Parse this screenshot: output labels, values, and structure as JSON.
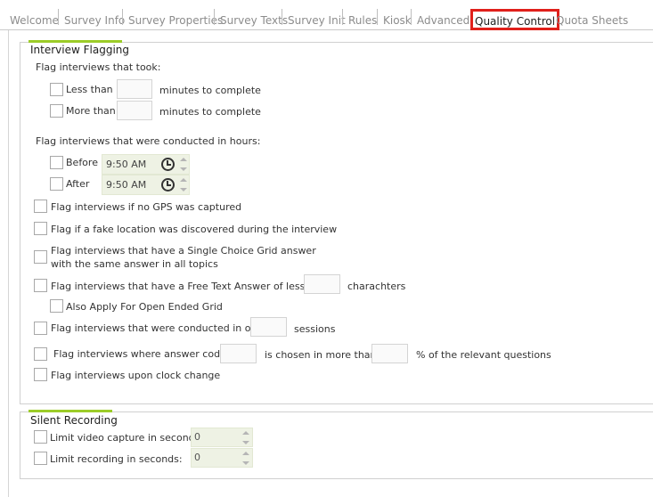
{
  "tabs": [
    {
      "label": "Welcome",
      "active": false
    },
    {
      "label": "Survey Info",
      "active": false
    },
    {
      "label": "Survey Properties",
      "active": false
    },
    {
      "label": "Survey Texts",
      "active": false
    },
    {
      "label": "Survey Init",
      "active": false
    },
    {
      "label": "Rules",
      "active": false
    },
    {
      "label": "Kiosk",
      "active": false
    },
    {
      "label": "Advanced",
      "active": false
    },
    {
      "label": "Quality Control",
      "active": true
    },
    {
      "label": "Quota Sheets",
      "active": false
    }
  ],
  "colors": {
    "accent": "#9ccc28",
    "highlight": "#e0201b",
    "field_bg": "#eef2e4"
  },
  "interview_flagging": {
    "title": "Interview Flagging",
    "took_heading": "Flag interviews that took:",
    "less_than_label": "Less than",
    "more_than_label": "More than",
    "minutes_suffix": "minutes to complete",
    "less_than_value": "",
    "more_than_value": "",
    "hours_heading": "Flag interviews that were conducted in hours:",
    "before_label": "Before",
    "after_label": "After",
    "before_time": "9:50 AM",
    "after_time": "9:50 AM",
    "no_gps_label": "Flag interviews if no GPS was captured",
    "fake_location_label": "Flag if a fake location was discovered during the interview",
    "single_choice_label_1": "Flag interviews that have a Single Choice Grid answer",
    "single_choice_label_2": "with the same answer in all topics",
    "free_text_label": "Flag interviews that have a Free Text Answer of less than",
    "free_text_value": "",
    "characters_suffix": "charachters",
    "open_ended_label": "Also Apply For Open Ended Grid",
    "sessions_label": "Flag interviews that were conducted in over",
    "sessions_value": "",
    "sessions_suffix": "sessions",
    "coding_label": "Flag interviews where answer coding",
    "coding_value": "",
    "coding_mid": "is chosen in more than",
    "coding_percent_value": "",
    "coding_suffix": "% of the relevant questions",
    "clock_change_label": "Flag interviews upon clock change"
  },
  "silent_recording": {
    "title": "Silent Recording",
    "video_label": "Limit video capture in seconds:",
    "video_value": "0",
    "recording_label": "Limit recording in seconds:",
    "recording_value": "0"
  }
}
